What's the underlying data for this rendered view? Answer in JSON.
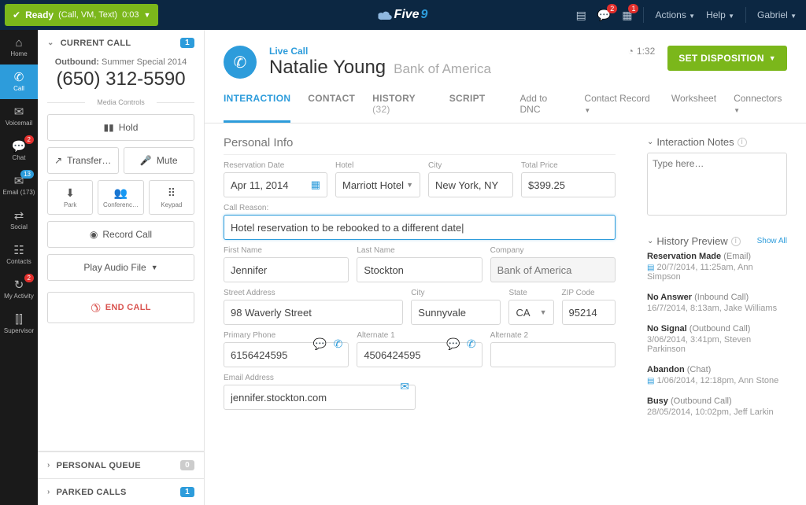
{
  "topbar": {
    "status": "Ready",
    "modes": "(Call, VM, Text)",
    "timer": "0:03",
    "logo_text": "Five",
    "logo_nine": "9",
    "notif_badge_chat": "2",
    "notif_badge_cal": "1",
    "menu_actions": "Actions",
    "menu_help": "Help",
    "menu_user": "Gabriel"
  },
  "leftnav": [
    {
      "label": "Home",
      "icon": "⌂"
    },
    {
      "label": "Call",
      "icon": "✆",
      "active": true
    },
    {
      "label": "Voicemail",
      "icon": "✉"
    },
    {
      "label": "Chat",
      "icon": "💬",
      "badge": "2"
    },
    {
      "label": "Email (173)",
      "icon": "✉",
      "badge": "13",
      "badge_blue": true
    },
    {
      "label": "Social",
      "icon": "⇄"
    },
    {
      "label": "Contacts",
      "icon": "☷"
    },
    {
      "label": "My Activity",
      "icon": "↻",
      "badge": "2"
    },
    {
      "label": "Supervisor",
      "icon": "⫿⫿"
    }
  ],
  "callpanel": {
    "current_call": "CURRENT CALL",
    "count_current": "1",
    "outbound_label": "Outbound:",
    "campaign": "Summer Special 2014",
    "phone": "(650) 312-5590",
    "media_controls": "Media Controls",
    "hold": "Hold",
    "transfer": "Transfer…",
    "mute": "Mute",
    "park": "Park",
    "conference": "Conferenc…",
    "keypad": "Keypad",
    "record": "Record Call",
    "play_audio": "Play Audio File",
    "end": "END CALL",
    "personal_queue": "PERSONAL QUEUE",
    "parked_calls": "PARKED CALLS",
    "count_personal": "0",
    "count_parked": "1"
  },
  "header": {
    "live": "Live Call",
    "name": "Natalie Young",
    "company": "Bank of America",
    "timer": "1:32",
    "disposition": "SET DISPOSITION"
  },
  "tabs": {
    "interaction": "INTERACTION",
    "contact": "CONTACT",
    "history": "HISTORY",
    "history_n": "(32)",
    "script": "SCRIPT",
    "add_dnc": "Add to DNC",
    "contact_record": "Contact Record",
    "worksheet": "Worksheet",
    "connectors": "Connectors"
  },
  "form": {
    "section": "Personal Info",
    "reservation_date_label": "Reservation Date",
    "reservation_date": "Apr 11, 2014",
    "hotel_label": "Hotel",
    "hotel": "Marriott Hotel",
    "city_label": "City",
    "city_hotel": "New York, NY",
    "total_label": "Total Price",
    "total": "$399.25",
    "reason_label": "Call Reason:",
    "reason": "Hotel reservation to be rebooked to a different date|",
    "first_label": "First Name",
    "first": "Jennifer",
    "last_label": "Last Name",
    "last": "Stockton",
    "company_label": "Company",
    "company": "Bank of America",
    "street_label": "Street Address",
    "street": "98 Waverly Street",
    "addr_city_label": "City",
    "addr_city": "Sunnyvale",
    "state_label": "State",
    "state": "CA",
    "zip_label": "ZIP Code",
    "zip": "95214",
    "primary_label": "Primary Phone",
    "primary": "6156424595",
    "alt1_label": "Alternate 1",
    "alt1": "4506424595",
    "alt2_label": "Alternate 2",
    "alt2": "",
    "email_label": "Email Address",
    "email": "jennifer.stockton.com"
  },
  "notes": {
    "title": "Interaction Notes",
    "placeholder": "Type here…"
  },
  "history_preview": {
    "title": "History Preview",
    "show_all": "Show All",
    "items": [
      {
        "title": "Reservation Made",
        "type": "(Email)",
        "has_icon": true,
        "sub": "20/7/2014, 11:25am, Ann Simpson"
      },
      {
        "title": "No Answer",
        "type": "(Inbound Call)",
        "sub": "16/7/2014, 8:13am, Jake Williams"
      },
      {
        "title": "No Signal",
        "type": "(Outbound Call)",
        "sub": "3/06/2014, 3:41pm, Steven Parkinson"
      },
      {
        "title": "Abandon",
        "type": "(Chat)",
        "has_icon": true,
        "sub": "1/06/2014, 12:18pm, Ann Stone"
      },
      {
        "title": "Busy",
        "type": "(Outbound Call)",
        "sub": "28/05/2014, 10:02pm, Jeff Larkin"
      }
    ]
  }
}
